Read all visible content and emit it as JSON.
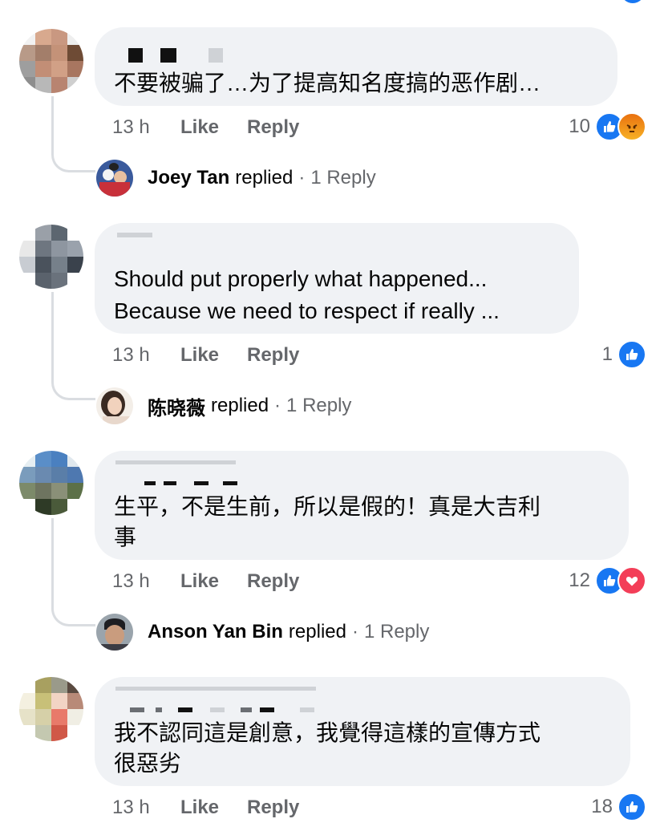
{
  "comments": [
    {
      "text": "不要被骗了…为了提高知名度搞的恶作剧…",
      "time": "13 h",
      "like_label": "Like",
      "reply_label": "Reply",
      "reaction_count": "10",
      "reactions": [
        "like-icon",
        "angry-icon"
      ],
      "reply": {
        "name": "Joey Tan",
        "verb": "replied",
        "dot": "·",
        "count": "1 Reply"
      }
    },
    {
      "text_line1": "Should put properly what happened...",
      "text_line2": "Because we need to respect if really ...",
      "time": "13 h",
      "like_label": "Like",
      "reply_label": "Reply",
      "reaction_count": "1",
      "reactions": [
        "like-icon"
      ],
      "reply": {
        "name": "陈晓薇",
        "verb": "replied",
        "dot": "·",
        "count": "1 Reply"
      }
    },
    {
      "text_line1": "生平，不是生前，所以是假的！真是大吉利",
      "text_line2": "事",
      "time": "13 h",
      "like_label": "Like",
      "reply_label": "Reply",
      "reaction_count": "12",
      "reactions": [
        "like-icon",
        "love-icon"
      ],
      "reply": {
        "name": "Anson Yan Bin",
        "verb": "replied",
        "dot": "·",
        "count": "1 Reply"
      }
    },
    {
      "text_line1": "我不認同這是創意，我覺得這樣的宣傳方式",
      "text_line2": "很惡劣",
      "time": "13 h",
      "like_label": "Like",
      "reply_label": "Reply",
      "reaction_count": "18",
      "reactions": [
        "like-icon"
      ]
    }
  ],
  "colors": {
    "bubble": "#f0f2f5",
    "secondary_text": "#65676b",
    "like_blue": "#1877f2",
    "love_red": "#f33e58",
    "angry_orange": "#e9710f",
    "thread_line": "#dadde1"
  }
}
